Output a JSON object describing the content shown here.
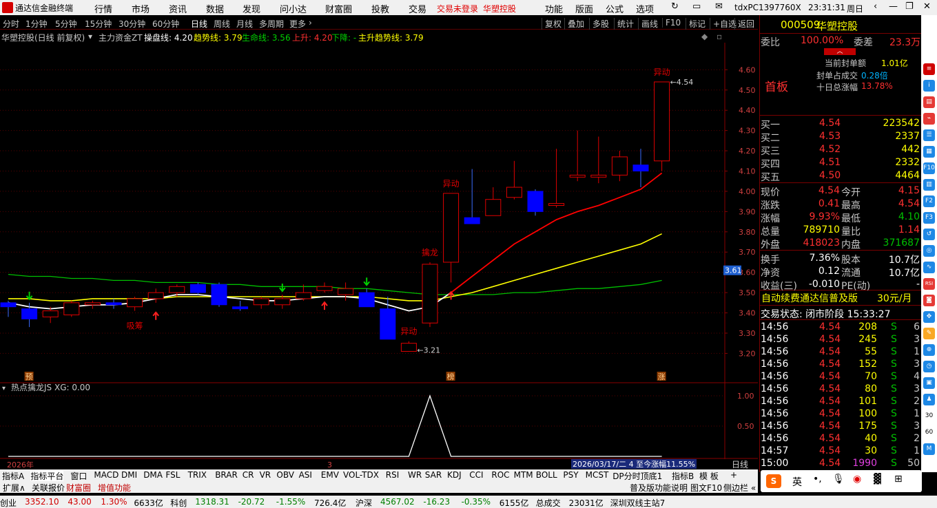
{
  "titlebar": {
    "app_name": "通达信金融终端",
    "menus": [
      "行情",
      "市场",
      "资讯",
      "数据",
      "发现",
      "问小达",
      "财富圈",
      "投教",
      "交易"
    ],
    "trade_status": "交易未登录",
    "stock_name": "华塑控股",
    "right_menus": [
      "功能",
      "版面",
      "公式",
      "选项"
    ],
    "machine_id": "tdxPC1397760X",
    "clock": "23:31:31",
    "weekday": "周日"
  },
  "periodbar": {
    "periods": [
      "分时",
      "1分钟",
      "5分钟",
      "15分钟",
      "30分钟",
      "60分钟",
      "日线",
      "周线",
      "月线",
      "多周期",
      "更多"
    ],
    "active": "日线",
    "right_buttons": [
      "复权",
      "叠加",
      "多股",
      "统计",
      "画线",
      "F10",
      "标记",
      "+自选",
      "返回"
    ]
  },
  "infoline": {
    "name": "华塑控股(日线 前复权)",
    "indicator": "主力资金ZT",
    "cpx_label": "操盘线: 4.20",
    "trend_label": "趋势线: 3.79",
    "life_label": "生命线: 3.56",
    "up_label": "上升: 4.20",
    "down_label": "下降: -",
    "main_up_label": "主升趋势线: 3.79"
  },
  "chart_data": {
    "type": "candlestick",
    "title": "华塑控股(日线 前复权)",
    "y_ticks": [
      3.2,
      3.3,
      3.4,
      3.5,
      3.6,
      3.7,
      3.8,
      3.9,
      4.0,
      4.1,
      4.2,
      4.3,
      4.4,
      4.5,
      4.6
    ],
    "y_range": [
      3.13,
      4.72
    ],
    "current_price_tag": "3.61",
    "candles": [
      {
        "o": 3.45,
        "h": 3.46,
        "l": 3.38,
        "c": 3.43
      },
      {
        "o": 3.42,
        "h": 3.45,
        "l": 3.33,
        "c": 3.37
      },
      {
        "o": 3.38,
        "h": 3.43,
        "l": 3.35,
        "c": 3.41
      },
      {
        "o": 3.39,
        "h": 3.46,
        "l": 3.38,
        "c": 3.45
      },
      {
        "o": 3.44,
        "h": 3.46,
        "l": 3.42,
        "c": 3.45
      },
      {
        "o": 3.45,
        "h": 3.47,
        "l": 3.42,
        "c": 3.44
      },
      {
        "o": 3.43,
        "h": 3.48,
        "l": 3.41,
        "c": 3.47
      },
      {
        "o": 3.47,
        "h": 3.52,
        "l": 3.45,
        "c": 3.5
      },
      {
        "o": 3.5,
        "h": 3.54,
        "l": 3.48,
        "c": 3.53
      },
      {
        "o": 3.54,
        "h": 3.55,
        "l": 3.49,
        "c": 3.5
      },
      {
        "o": 3.54,
        "h": 3.55,
        "l": 3.43,
        "c": 3.44
      },
      {
        "o": 3.43,
        "h": 3.46,
        "l": 3.41,
        "c": 3.42
      },
      {
        "o": 3.44,
        "h": 3.48,
        "l": 3.42,
        "c": 3.47
      },
      {
        "o": 3.44,
        "h": 3.49,
        "l": 3.42,
        "c": 3.47
      },
      {
        "o": 3.47,
        "h": 3.54,
        "l": 3.46,
        "c": 3.5
      },
      {
        "o": 3.51,
        "h": 3.55,
        "l": 3.5,
        "c": 3.53
      },
      {
        "o": 3.49,
        "h": 3.55,
        "l": 3.46,
        "c": 3.52
      },
      {
        "o": 3.5,
        "h": 3.52,
        "l": 3.44,
        "c": 3.43
      },
      {
        "o": 3.42,
        "h": 3.48,
        "l": 3.27,
        "c": 3.27
      },
      {
        "o": 3.21,
        "h": 3.26,
        "l": 3.21,
        "c": 3.25
      },
      {
        "o": 3.35,
        "h": 3.65,
        "l": 3.33,
        "c": 3.64
      },
      {
        "o": 3.65,
        "h": 3.99,
        "l": 3.55,
        "c": 3.99
      },
      {
        "o": 3.87,
        "h": 4.11,
        "l": 3.84,
        "c": 3.84
      },
      {
        "o": 3.88,
        "h": 4.02,
        "l": 3.88,
        "c": 3.96
      },
      {
        "o": 3.97,
        "h": 4.15,
        "l": 3.96,
        "c": 4.02
      },
      {
        "o": 4.0,
        "h": 4.01,
        "l": 3.88,
        "c": 3.9
      },
      {
        "o": 3.93,
        "h": 4.21,
        "l": 3.92,
        "c": 3.94
      },
      {
        "o": 4.07,
        "h": 4.3,
        "l": 4.05,
        "c": 4.08
      },
      {
        "o": 4.07,
        "h": 4.27,
        "l": 4.04,
        "c": 4.08
      },
      {
        "o": 4.08,
        "h": 4.2,
        "l": 4.05,
        "c": 4.17
      },
      {
        "o": 4.13,
        "h": 4.21,
        "l": 4.02,
        "c": 4.1
      },
      {
        "o": 4.15,
        "h": 4.54,
        "l": 4.1,
        "c": 4.54
      }
    ],
    "series": [
      {
        "name": "操盘线",
        "values": [
          3.45,
          3.43,
          3.42,
          3.43,
          3.44,
          3.44,
          3.45,
          3.47,
          3.49,
          3.49,
          3.48,
          3.47,
          3.46,
          3.46,
          3.47,
          3.48,
          3.48,
          3.47,
          3.44,
          3.41,
          3.43,
          3.5,
          3.58,
          3.66,
          3.74,
          3.8,
          3.86,
          3.9,
          3.93,
          3.97,
          4.01,
          4.09
        ]
      },
      {
        "name": "趋势线",
        "values": [
          3.47,
          3.47,
          3.46,
          3.46,
          3.47,
          3.47,
          3.47,
          3.47,
          3.48,
          3.48,
          3.48,
          3.48,
          3.48,
          3.48,
          3.48,
          3.48,
          3.48,
          3.48,
          3.47,
          3.46,
          3.46,
          3.48,
          3.5,
          3.53,
          3.56,
          3.59,
          3.62,
          3.65,
          3.68,
          3.71,
          3.74,
          3.79
        ]
      },
      {
        "name": "生命线",
        "values": [
          3.59,
          3.58,
          3.58,
          3.57,
          3.57,
          3.56,
          3.56,
          3.55,
          3.55,
          3.55,
          3.54,
          3.54,
          3.53,
          3.53,
          3.53,
          3.53,
          3.52,
          3.52,
          3.51,
          3.5,
          3.49,
          3.49,
          3.49,
          3.49,
          3.5,
          3.5,
          3.51,
          3.52,
          3.52,
          3.53,
          3.54,
          3.56
        ]
      }
    ],
    "annotations": [
      {
        "text": "吸筹",
        "index": 6,
        "color": "#e00000"
      },
      {
        "text": "异动",
        "index": 19,
        "color": "#e00000"
      },
      {
        "text": "擒龙",
        "index": 20,
        "color": "#e00000"
      },
      {
        "text": "异动",
        "index": 21,
        "color": "#e00000"
      },
      {
        "text": "异动",
        "index": 31,
        "color": "#e00000"
      }
    ],
    "price_labels": [
      {
        "text": "3.21",
        "index": 19
      },
      {
        "text": "4.54",
        "index": 31
      }
    ],
    "bottom_markers": [
      {
        "text": "预",
        "index": 1
      },
      {
        "text": "榜",
        "index": 21
      },
      {
        "text": "涨",
        "index": 31
      }
    ],
    "sub_chart": {
      "title": "热点擒龙JS XG: 0.00",
      "y_ticks": [
        0.5,
        1.0
      ],
      "values": [
        0,
        0,
        0,
        0,
        0,
        0,
        0,
        0,
        0,
        0,
        0,
        0,
        0,
        0,
        0,
        0,
        0,
        0,
        0,
        0,
        1,
        0,
        0,
        0,
        0,
        0,
        0,
        0,
        0,
        0,
        0,
        0
      ]
    },
    "x_labels": [
      "2026年",
      "3"
    ],
    "status_text": "2026/03/17/二 4 至今涨幅11.55%",
    "period_label": "日线"
  },
  "quote": {
    "code": "000509",
    "name": "华塑控股",
    "weibi_label": "委比",
    "weibi_value": "100.00%",
    "weicha_label": "委差",
    "weicha_value": "23.3万",
    "board_tag": "首板",
    "seal_amount_label": "当前封单额",
    "seal_amount": "1.01亿",
    "seal_ratio_label": "封单占成交",
    "seal_ratio": "0.28倍",
    "ten_day_label": "十日总涨幅",
    "ten_day": "13.78%",
    "bids": [
      {
        "label": "买一",
        "price": "4.54",
        "vol": "223542"
      },
      {
        "label": "买二",
        "price": "4.53",
        "vol": "2337"
      },
      {
        "label": "买三",
        "price": "4.52",
        "vol": "442"
      },
      {
        "label": "买四",
        "price": "4.51",
        "vol": "2332"
      },
      {
        "label": "买五",
        "price": "4.50",
        "vol": "4464"
      }
    ],
    "stats": [
      {
        "l1": "现价",
        "v1": "4.54",
        "l2": "今开",
        "v2": "4.15"
      },
      {
        "l1": "涨跌",
        "v1": "0.41",
        "l2": "最高",
        "v2": "4.54"
      },
      {
        "l1": "涨幅",
        "v1": "9.93%",
        "l2": "最低",
        "v2": "4.10"
      },
      {
        "l1": "总量",
        "v1": "789710",
        "l2": "量比",
        "v2": "1.14"
      },
      {
        "l1": "外盘",
        "v1": "418023",
        "l2": "内盘",
        "v2": "371687"
      }
    ],
    "stats2": [
      {
        "l1": "换手",
        "v1": "7.36%",
        "l2": "股本",
        "v2": "10.7亿"
      },
      {
        "l1": "净资",
        "v1": "0.12",
        "l2": "流通",
        "v2": "10.7亿"
      },
      {
        "l1": "收益(三)",
        "v1": "-0.010",
        "l2": "PE(动)",
        "v2": "-"
      }
    ],
    "promo": "自动续费通达信普及版",
    "promo_price": "30元/月",
    "trade_state": "交易状态: 闭市阶段 15:33:27",
    "ticks": [
      {
        "t": "14:56",
        "p": "4.54",
        "v": "208",
        "s": "S",
        "n": "6"
      },
      {
        "t": "14:56",
        "p": "4.54",
        "v": "245",
        "s": "S",
        "n": "3"
      },
      {
        "t": "14:56",
        "p": "4.54",
        "v": "55",
        "s": "S",
        "n": "1"
      },
      {
        "t": "14:56",
        "p": "4.54",
        "v": "152",
        "s": "S",
        "n": "3"
      },
      {
        "t": "14:56",
        "p": "4.54",
        "v": "70",
        "s": "S",
        "n": "4"
      },
      {
        "t": "14:56",
        "p": "4.54",
        "v": "80",
        "s": "S",
        "n": "3"
      },
      {
        "t": "14:56",
        "p": "4.54",
        "v": "101",
        "s": "S",
        "n": "2"
      },
      {
        "t": "14:56",
        "p": "4.54",
        "v": "100",
        "s": "S",
        "n": "1"
      },
      {
        "t": "14:56",
        "p": "4.54",
        "v": "175",
        "s": "S",
        "n": "3"
      },
      {
        "t": "14:56",
        "p": "4.54",
        "v": "40",
        "s": "S",
        "n": "2"
      },
      {
        "t": "14:57",
        "p": "4.54",
        "v": "30",
        "s": "S",
        "n": "1"
      },
      {
        "t": "15:00",
        "p": "4.54",
        "v": "1990",
        "s": "S",
        "n": "50"
      }
    ]
  },
  "tabs": {
    "row1": [
      "指标A",
      "指标平台",
      "窗口",
      "MACD",
      "DMI",
      "DMA",
      "FSL",
      "TRIX",
      "BRAR",
      "CR",
      "VR",
      "OBV",
      "ASI",
      "EMV",
      "VOL-TDX",
      "RSI",
      "WR",
      "SAR",
      "KDJ",
      "CCI",
      "ROC",
      "MTM",
      "BOLL",
      "PSY",
      "MCST",
      "DP分时顶底1"
    ],
    "row1_right": [
      "指标B",
      "模 板",
      "+"
    ],
    "row2": [
      "扩展∧",
      "关联报价",
      "财富圈",
      "增值功能"
    ],
    "row2_right": [
      "普及版功能说明",
      "图文F10",
      "侧边栏 «"
    ]
  },
  "ime": [
    "英"
  ],
  "statusbar": {
    "items": [
      {
        "t": "创业",
        "c": "#000"
      },
      {
        "t": "3352.10",
        "c": "#d00000"
      },
      {
        "t": "43.00",
        "c": "#d00000"
      },
      {
        "t": "1.30%",
        "c": "#d00000"
      },
      {
        "t": "6633亿",
        "c": "#000"
      },
      {
        "t": "科创",
        "c": "#000"
      },
      {
        "t": "1318.31",
        "c": "#008000"
      },
      {
        "t": "-20.72",
        "c": "#008000"
      },
      {
        "t": "-1.55%",
        "c": "#008000"
      },
      {
        "t": "726.4亿",
        "c": "#000"
      },
      {
        "t": "沪深",
        "c": "#000"
      },
      {
        "t": "4567.02",
        "c": "#008000"
      },
      {
        "t": "-16.23",
        "c": "#008000"
      },
      {
        "t": "-0.35%",
        "c": "#008000"
      },
      {
        "t": "6155亿",
        "c": "#000"
      },
      {
        "t": "总成交",
        "c": "#000"
      },
      {
        "t": "23031亿",
        "c": "#000"
      },
      {
        "t": "深圳双线主站7",
        "c": "#000"
      }
    ]
  },
  "colors": {
    "up": "#e00000",
    "down": "#0000ff",
    "bull_text": "#ff4040",
    "bear_text": "#00c000",
    "cpx_line": "#ffffff",
    "cpx_up": "#ff0000",
    "trend_line": "#ffff00",
    "life_line": "#00c000"
  }
}
